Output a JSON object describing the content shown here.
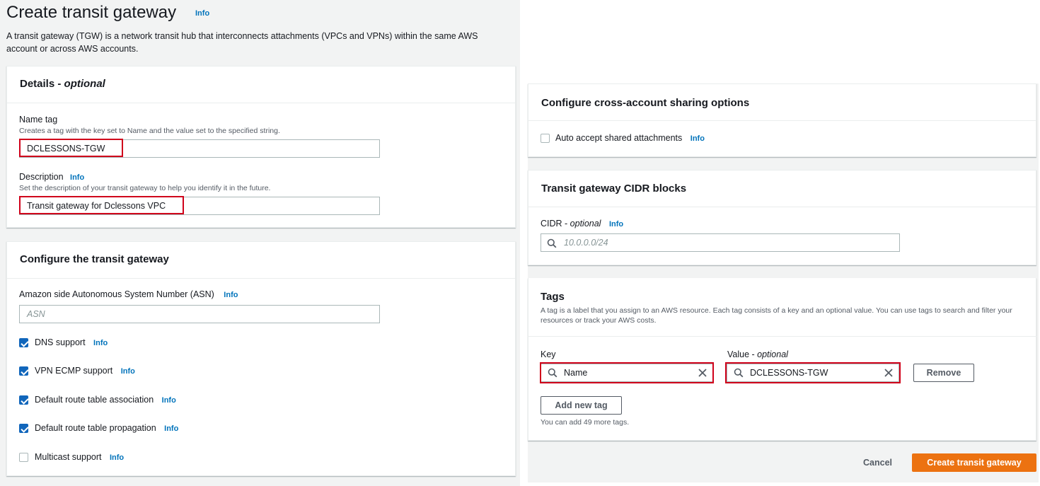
{
  "page": {
    "title": "Create transit gateway",
    "title_info": "Info",
    "description": "A transit gateway (TGW) is a network transit hub that interconnects attachments (VPCs and VPNs) within the same AWS account or across AWS accounts."
  },
  "details": {
    "header": "Details - ",
    "header_optional": "optional",
    "name_tag_label": "Name tag",
    "name_tag_hint": "Creates a tag with the key set to Name and the value set to the specified string.",
    "name_tag_value": "DCLESSONS-TGW",
    "description_label": "Description",
    "description_info": "Info",
    "description_hint": "Set the description of your transit gateway to help you identify it in the future.",
    "description_value": "Transit gateway for Dclessons VPC"
  },
  "configure": {
    "header": "Configure the transit gateway",
    "asn_label": "Amazon side Autonomous System Number (ASN)",
    "asn_info": "Info",
    "asn_placeholder": "ASN",
    "options": [
      {
        "label": "DNS support",
        "info": "Info",
        "checked": true
      },
      {
        "label": "VPN ECMP support",
        "info": "Info",
        "checked": true
      },
      {
        "label": "Default route table association",
        "info": "Info",
        "checked": true
      },
      {
        "label": "Default route table propagation",
        "info": "Info",
        "checked": true
      },
      {
        "label": "Multicast support",
        "info": "Info",
        "checked": false
      }
    ]
  },
  "sharing": {
    "header": "Configure cross-account sharing options",
    "auto_accept_label": "Auto accept shared attachments",
    "auto_accept_info": "Info",
    "auto_accept_checked": false
  },
  "cidr": {
    "header": "Transit gateway CIDR blocks",
    "label": "CIDR - ",
    "label_optional": "optional",
    "info": "Info",
    "placeholder": "10.0.0.0/24"
  },
  "tags": {
    "header": "Tags",
    "description": "A tag is a label that you assign to an AWS resource. Each tag consists of a key and an optional value. You can use tags to search and filter your resources or track your AWS costs.",
    "key_label": "Key",
    "value_label": "Value - ",
    "value_label_optional": "optional",
    "key_value": "Name",
    "value_value": "DCLESSONS-TGW",
    "remove_button": "Remove",
    "add_button": "Add new tag",
    "remaining": "You can add 49 more tags."
  },
  "footer": {
    "cancel": "Cancel",
    "create": "Create transit gateway"
  },
  "colors": {
    "primary": "#ec7211",
    "link": "#0073bb",
    "checkbox": "#1166bb",
    "highlight": "#d0021b"
  }
}
